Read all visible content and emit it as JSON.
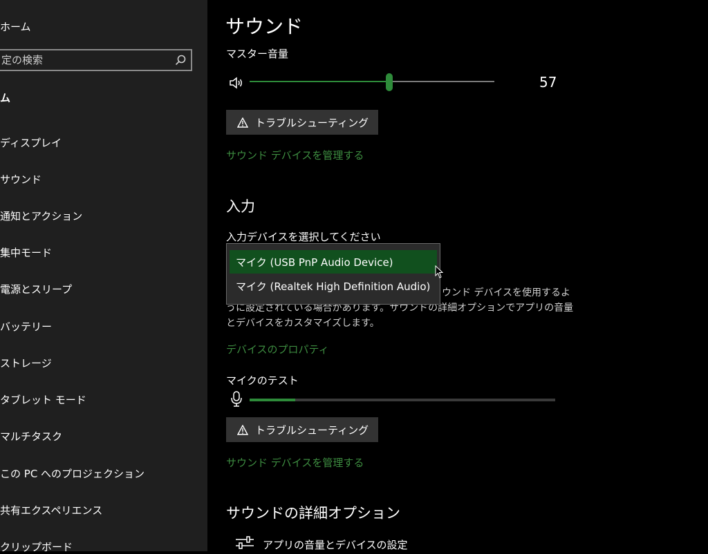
{
  "sidebar": {
    "home_label": "ホーム",
    "search_placeholder": "定の検索",
    "section_heading": "ム",
    "items": [
      {
        "label": "ディスプレイ"
      },
      {
        "label": "サウンド"
      },
      {
        "label": "通知とアクション"
      },
      {
        "label": "集中モード"
      },
      {
        "label": "電源とスリープ"
      },
      {
        "label": "バッテリー"
      },
      {
        "label": "ストレージ"
      },
      {
        "label": "タブレット モード"
      },
      {
        "label": "マルチタスク"
      },
      {
        "label": "この PC へのプロジェクション"
      },
      {
        "label": "共有エクスペリエンス"
      },
      {
        "label": "クリップボード"
      }
    ]
  },
  "main": {
    "page_title": "サウンド",
    "master_volume_label": "マスター音量",
    "master_volume_value": "57",
    "troubleshoot_label": "トラブルシューティング",
    "manage_devices_link": "サウンド デバイスを管理する",
    "input_heading": "入力",
    "select_input_label": "入力デバイスを選択してください",
    "input_devices": [
      {
        "label": "マイク (USB PnP Audio Device)",
        "selected": true
      },
      {
        "label": "マイク (Realtek High Definition Audio)",
        "selected": false
      }
    ],
    "info_text_lines": [
      "ウンド デバイスを使用するよ",
      "うに設定されている場合があります。サウンドの詳細オプションでアプリの音量",
      "とデバイスをカスタマイズします。"
    ],
    "device_properties_link": "デバイスのプロパティ",
    "mic_test_label": "マイクのテスト",
    "mic_level": 0.15,
    "troubleshoot_label_2": "トラブルシューティング",
    "manage_devices_link_2": "サウンド デバイスを管理する",
    "advanced_heading": "サウンドの詳細オプション",
    "app_volume_label": "アプリの音量とデバイスの設定"
  },
  "colors": {
    "accent": "#2e8b3a",
    "link": "#3d8c40",
    "sidebar_bg": "#1f1f1f",
    "button_bg": "#333333",
    "selected_option_bg": "#11501e"
  }
}
